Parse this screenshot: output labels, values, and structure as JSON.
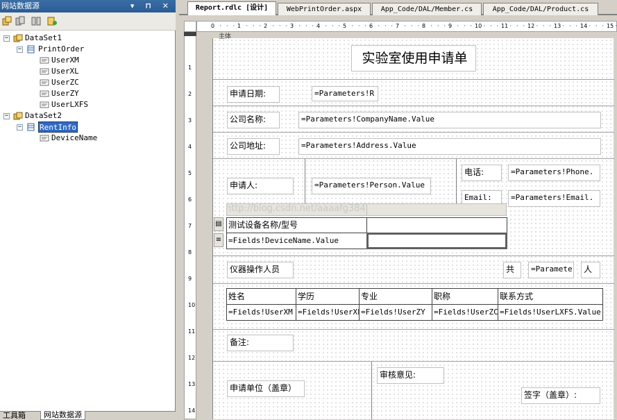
{
  "left_panel": {
    "title": "网站数据源",
    "title_buttons": "▾ ⊓ ✕",
    "tree": [
      {
        "label": "DataSet1",
        "level": 0,
        "expander": "−",
        "icon": "dataset-icon"
      },
      {
        "label": "PrintOrder",
        "level": 1,
        "expander": "−",
        "icon": "table-icon"
      },
      {
        "label": "UserXM",
        "level": 2,
        "icon": "field-icon"
      },
      {
        "label": "UserXL",
        "level": 2,
        "icon": "field-icon"
      },
      {
        "label": "UserZC",
        "level": 2,
        "icon": "field-icon"
      },
      {
        "label": "UserZY",
        "level": 2,
        "icon": "field-icon"
      },
      {
        "label": "UserLXFS",
        "level": 2,
        "icon": "field-icon"
      },
      {
        "label": "DataSet2",
        "level": 0,
        "expander": "−",
        "icon": "dataset-icon"
      },
      {
        "label": "RentInfo",
        "level": 1,
        "expander": "−",
        "icon": "table-icon",
        "selected": true
      },
      {
        "label": "DeviceName",
        "level": 2,
        "icon": "field-icon"
      }
    ],
    "bottom_tabs": [
      "工具箱",
      "网站数据源"
    ]
  },
  "tabs": [
    {
      "label": "Report.rdlc [设计]",
      "active": true
    },
    {
      "label": "WebPrintOrder.aspx",
      "active": false
    },
    {
      "label": "App_Code/DAL/Member.cs",
      "active": false
    },
    {
      "label": "App_Code/DAL/Product.cs",
      "active": false
    }
  ],
  "ruler": {
    "h": [
      "0",
      "1",
      "2",
      "3",
      "4",
      "5",
      "6",
      "7",
      "8",
      "9",
      "10",
      "11",
      "12",
      "13",
      "14",
      "15"
    ],
    "v": [
      "1",
      "2",
      "3",
      "4",
      "5",
      "6",
      "7",
      "8",
      "9",
      "10",
      "11",
      "12",
      "13",
      "14"
    ],
    "body_marker": "主体"
  },
  "report": {
    "title": "实验室使用申请单",
    "apply_date_label": "申请日期:",
    "apply_date_value": "=Parameters!R",
    "company_label": "公司名称:",
    "company_value": "=Parameters!CompanyName.Value",
    "address_label": "公司地址:",
    "address_value": "=Parameters!Address.Value",
    "applicant_label": "申请人:",
    "applicant_value": "=Parameters!Person.Value",
    "phone_label": "电话:",
    "phone_value": "=Parameters!Phone.",
    "email_label": "Email:",
    "email_value": "=Parameters!Email.",
    "device_header": "测试设备名称/型号",
    "device_value": "=Fields!DeviceName.Value",
    "operators_label": "仪器操作人员",
    "total_label": "共",
    "total_value": "=Paramete",
    "person_unit": "人",
    "staff_headers": [
      "姓名",
      "学历",
      "专业",
      "职称",
      "联系方式"
    ],
    "staff_values": [
      "=Fields!UserXM",
      "=Fields!UserXL",
      "=Fields!UserZY",
      "=Fields!UserZC",
      "=Fields!UserLXFS.Value"
    ],
    "remark_label": "备注:",
    "unit_label": "申请单位（盖章）",
    "review_label": "审核意见:",
    "sign_label": "签字（盖章）:",
    "watermark": "http://blog.csdn.net/aaaafg384"
  }
}
